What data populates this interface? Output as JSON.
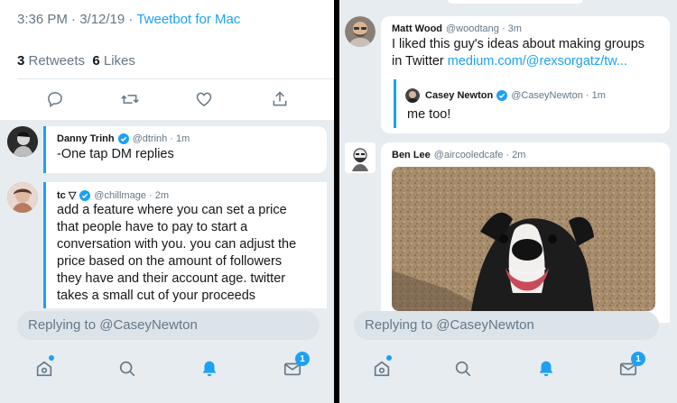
{
  "left": {
    "timestamp": "3:36 PM · 3/12/19 · ",
    "client": "Tweetbot for Mac",
    "retweets_count": "3",
    "retweets_label": " Retweets  ",
    "likes_count": "6",
    "likes_label": " Likes",
    "replies": [
      {
        "name": "Danny Trinh",
        "handle": "@dtrinh · 1m",
        "text": "-One tap DM replies"
      },
      {
        "name": "tc ▽",
        "handle": "@chillmage · 2m",
        "lines": [
          "add a feature where you can set a price",
          "that people have to pay to start a",
          "conversation with you. you can adjust the",
          "price based on the amount of followers",
          "they have and their account age. twitter",
          "takes a small cut of your proceeds"
        ]
      }
    ],
    "reply_placeholder": "Replying to @CaseyNewton",
    "dm_badge": "1"
  },
  "right": {
    "tweet1": {
      "name": "Matt Wood",
      "handle": "@woodtang · 3m",
      "line1": "I liked this guy's ideas about making groups",
      "line2_prefix": "in Twitter ",
      "link": "medium.com/@rexsorgatz/tw..."
    },
    "quote": {
      "name": "Casey Newton",
      "handle": "@CaseyNewton · 1m",
      "text": "me too!"
    },
    "tweet2": {
      "name": "Ben Lee",
      "handle": "@aircooledcafe · 2m"
    },
    "reply_placeholder": "Replying to @CaseyNewton",
    "dm_badge": "1"
  },
  "colors": {
    "accent": "#1da1f2",
    "background": "#e6ecf0",
    "text_secondary": "#657786"
  }
}
